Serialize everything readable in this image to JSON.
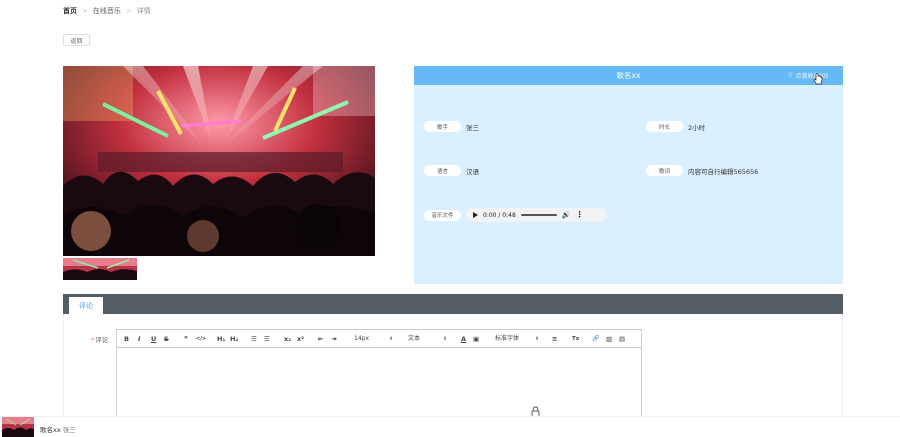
{
  "breadcrumb": {
    "home": "首页",
    "sep": ">",
    "section": "在线音乐",
    "current": "详情"
  },
  "back_label": "返回",
  "info": {
    "title": "歌名xx",
    "fav_label": "点我收藏(0)",
    "fields": {
      "singer": {
        "label": "歌手",
        "value": "张三"
      },
      "duration": {
        "label": "时长",
        "value": "2小时"
      },
      "language": {
        "label": "语言",
        "value": "汉语"
      },
      "lyrics": {
        "label": "歌词",
        "value": "内容可自行编辑565656"
      },
      "audio": {
        "label": "音乐文件",
        "time": "0:00 / 0:48"
      }
    }
  },
  "tabs": {
    "comment": "评论"
  },
  "comment": {
    "required_mark": "*",
    "label": "评论"
  },
  "toolbar": {
    "bold": "B",
    "italic": "I",
    "underline": "U",
    "strike": "S",
    "quote": "❞",
    "code": "</>",
    "h1": "H₁",
    "h2": "H₂",
    "ol": "☰",
    "ul": "☰",
    "sub": "x₂",
    "sup": "x²",
    "indent_out": "⇤",
    "indent_in": "⇥",
    "size": "14px",
    "text": "文本",
    "font": "标准字体",
    "color": "A",
    "bg": "▣",
    "align": "≡",
    "clean": "Tx",
    "link": "🔗",
    "image": "▨",
    "video": "▤"
  },
  "player": {
    "song": "歌名xx",
    "singer": "张三"
  },
  "colors": {
    "header": "#66b9f4",
    "panel": "#daefff",
    "tabs_bar": "#545c64",
    "accent": "#409eff"
  }
}
